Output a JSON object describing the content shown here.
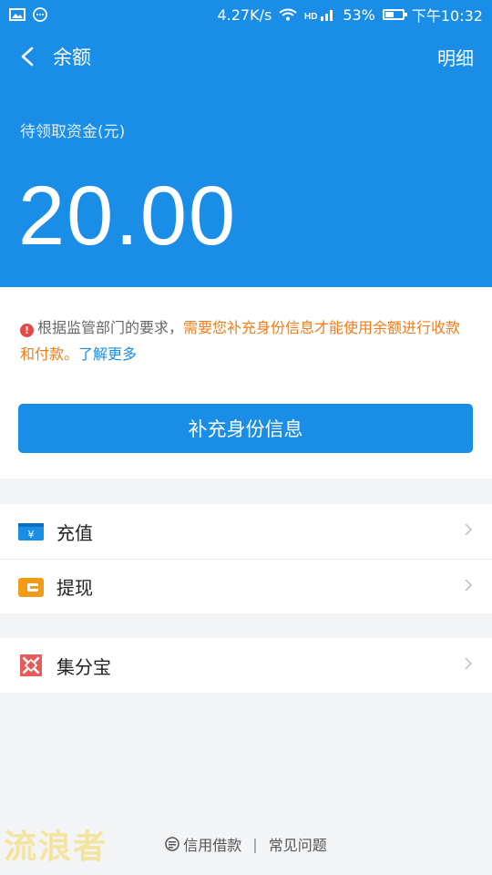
{
  "status_bar": {
    "speed": "4.27K/s",
    "battery": "53%",
    "battery_level": 0.53,
    "time": "下午10:32"
  },
  "nav": {
    "title": "余额",
    "detail": "明细"
  },
  "balance": {
    "label": "待领取资金(元)",
    "amount": "20.00"
  },
  "notice": {
    "prefix": "根据监管部门的要求，",
    "highlight": "需要您补充身份信息才能使用余额进行收款和付款。",
    "link": "了解更多"
  },
  "primary_button": "补充身份信息",
  "list_group1": [
    {
      "label": "充值",
      "icon": "recharge-icon"
    },
    {
      "label": "提现",
      "icon": "withdraw-icon"
    }
  ],
  "list_group2": [
    {
      "label": "集分宝",
      "icon": "jifenbao-icon"
    }
  ],
  "footer": {
    "left": "信用借款",
    "separator": "|",
    "right": "常见问题"
  },
  "watermark": "流浪者",
  "colors": {
    "primary": "#1a8ee6",
    "warning": "#f07d1a",
    "error": "#e54848"
  }
}
